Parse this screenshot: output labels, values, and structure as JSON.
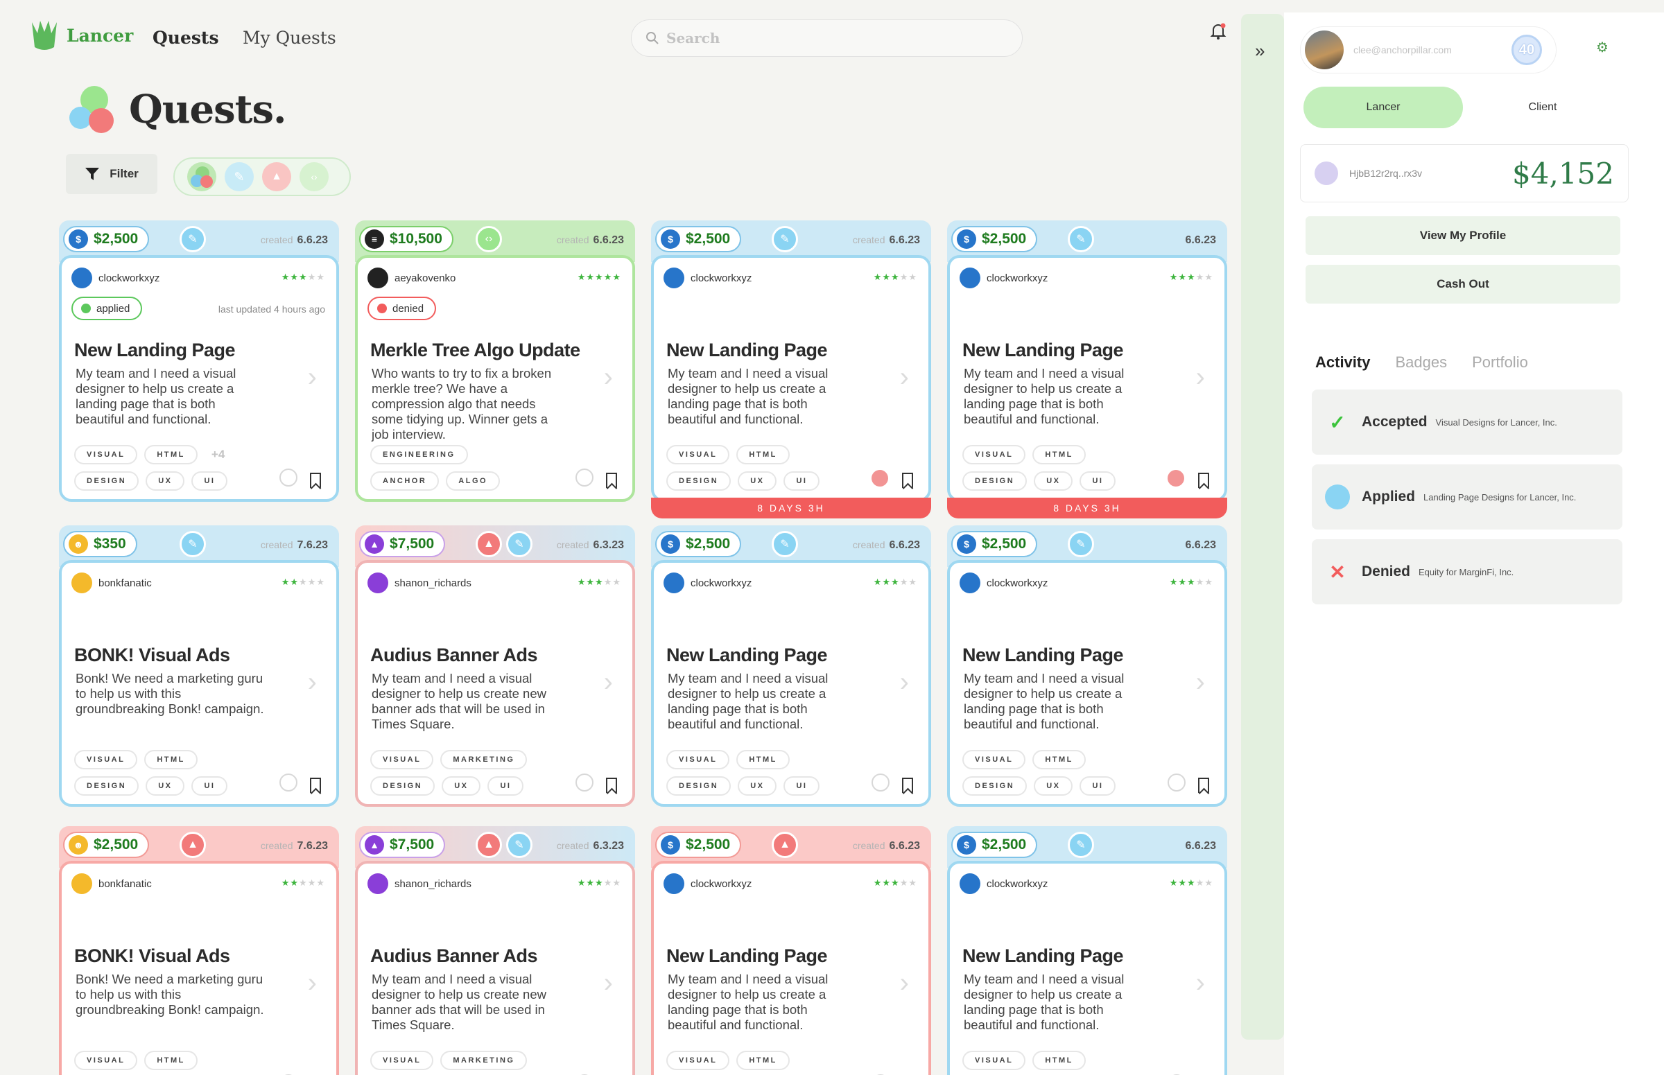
{
  "app": {
    "name": "Lancer",
    "nav": [
      "Quests",
      "My Quests"
    ]
  },
  "search": {
    "placeholder": "Search"
  },
  "page": {
    "title": "Quests.",
    "filter_label": "Filter"
  },
  "colors": {
    "brand": "#3f9c3f",
    "accent_green": "#c3efbb",
    "blue": "#9fd8f1",
    "red": "#f7a9a6"
  },
  "cards": [
    {
      "theme": "blue",
      "bounty": "$2,500",
      "coin": "usdc",
      "cats": [
        "design"
      ],
      "created_label": "created",
      "created": "6.6.23",
      "user": "clockworkxyz",
      "stars": 3,
      "status": "applied",
      "updated": "last updated 4 hours ago",
      "title": "New Landing Page",
      "desc": "My team and I need a visual designer to help us create a landing page that is both beautiful and functional.",
      "tags": [
        [
          "VISUAL",
          "HTML"
        ],
        [
          "DESIGN",
          "UX",
          "UI"
        ]
      ],
      "more": "+4",
      "deadline": ""
    },
    {
      "theme": "green",
      "bounty": "$10,500",
      "coin": "sol",
      "cats": [
        "engineering"
      ],
      "created_label": "created",
      "created": "6.6.23",
      "user": "aeyakovenko",
      "stars": 5,
      "status": "denied",
      "updated": "",
      "title": "Merkle Tree Algo Update",
      "desc": "Who wants to try to fix a broken merkle tree? We have a compression algo that needs some tidying up. Winner gets a job interview.",
      "tags": [
        [
          "ENGINEERING"
        ],
        [
          "ANCHOR",
          "ALGO"
        ]
      ],
      "more": "",
      "deadline": ""
    },
    {
      "theme": "blue",
      "bounty": "$2,500",
      "coin": "usdc",
      "cats": [
        "design"
      ],
      "created_label": "created",
      "created": "6.6.23",
      "user": "clockworkxyz",
      "stars": 3,
      "status": "",
      "updated": "",
      "title": "New Landing Page",
      "desc": "My team and I need a visual designer to help us create a landing page that is both beautiful and functional.",
      "tags": [
        [
          "VISUAL",
          "HTML"
        ],
        [
          "DESIGN",
          "UX",
          "UI"
        ]
      ],
      "more": "",
      "deadline": "8 DAYS 3H"
    },
    {
      "theme": "blue",
      "bounty": "$2,500",
      "coin": "usdc",
      "cats": [
        "design"
      ],
      "created_label": "",
      "created": "6.6.23",
      "user": "clockworkxyz",
      "stars": 3,
      "status": "",
      "updated": "",
      "title": "New Landing Page",
      "desc": "My team and I need a visual designer to help us create a landing page that is both beautiful and functional.",
      "tags": [
        [
          "VISUAL",
          "HTML"
        ],
        [
          "DESIGN",
          "UX",
          "UI"
        ]
      ],
      "more": "",
      "deadline": "8 DAYS 3H"
    },
    {
      "theme": "blue",
      "bounty": "$350",
      "coin": "bonk",
      "cats": [
        "design"
      ],
      "created_label": "created",
      "created": "7.6.23",
      "user": "bonkfanatic",
      "stars": 2,
      "status": "",
      "updated": "",
      "title": "BONK! Visual Ads",
      "desc": "Bonk! We need a marketing guru to help us with this groundbreaking Bonk! campaign.",
      "tags": [
        [
          "VISUAL",
          "HTML"
        ],
        [
          "DESIGN",
          "UX",
          "UI"
        ]
      ],
      "more": "",
      "deadline": ""
    },
    {
      "theme": "mix",
      "bounty": "$7,500",
      "coin": "audius",
      "cats": [
        "marketing",
        "design"
      ],
      "created_label": "created",
      "created": "6.3.23",
      "user": "shanon_richards",
      "stars": 3,
      "status": "",
      "updated": "",
      "title": "Audius Banner Ads",
      "desc": "My team and I need a visual designer to help us create new banner ads that will be used in Times Square.",
      "tags": [
        [
          "VISUAL",
          "MARKETING"
        ],
        [
          "DESIGN",
          "UX",
          "UI"
        ]
      ],
      "more": "",
      "deadline": ""
    },
    {
      "theme": "blue",
      "bounty": "$2,500",
      "coin": "usdc",
      "cats": [
        "design"
      ],
      "created_label": "created",
      "created": "6.6.23",
      "user": "clockworkxyz",
      "stars": 3,
      "status": "",
      "updated": "",
      "title": "New Landing Page",
      "desc": "My team and I need a visual designer to help us create a landing page that is both beautiful and functional.",
      "tags": [
        [
          "VISUAL",
          "HTML"
        ],
        [
          "DESIGN",
          "UX",
          "UI"
        ]
      ],
      "more": "",
      "deadline": ""
    },
    {
      "theme": "blue",
      "bounty": "$2,500",
      "coin": "usdc",
      "cats": [
        "design"
      ],
      "created_label": "",
      "created": "6.6.23",
      "user": "clockworkxyz",
      "stars": 3,
      "status": "",
      "updated": "",
      "title": "New Landing Page",
      "desc": "My team and I need a visual designer to help us create a landing page that is both beautiful and functional.",
      "tags": [
        [
          "VISUAL",
          "HTML"
        ],
        [
          "DESIGN",
          "UX",
          "UI"
        ]
      ],
      "more": "",
      "deadline": ""
    },
    {
      "theme": "red",
      "bounty": "$2,500",
      "coin": "bonk",
      "cats": [
        "marketing"
      ],
      "created_label": "created",
      "created": "7.6.23",
      "user": "bonkfanatic",
      "stars": 2,
      "status": "",
      "updated": "",
      "title": "BONK! Visual Ads",
      "desc": "Bonk! We need a marketing guru to help us with this groundbreaking Bonk! campaign.",
      "tags": [
        [
          "VISUAL",
          "HTML"
        ]
      ],
      "more": "",
      "deadline": ""
    },
    {
      "theme": "mix",
      "bounty": "$7,500",
      "coin": "audius",
      "cats": [
        "marketing",
        "design"
      ],
      "created_label": "created",
      "created": "6.3.23",
      "user": "shanon_richards",
      "stars": 3,
      "status": "",
      "updated": "",
      "title": "Audius Banner Ads",
      "desc": "My team and I need a visual designer to help us create new banner ads that will be used in Times Square.",
      "tags": [
        [
          "VISUAL",
          "MARKETING"
        ]
      ],
      "more": "",
      "deadline": ""
    },
    {
      "theme": "red",
      "bounty": "$2,500",
      "coin": "usdc",
      "cats": [
        "marketing"
      ],
      "created_label": "created",
      "created": "6.6.23",
      "user": "clockworkxyz",
      "stars": 3,
      "status": "",
      "updated": "",
      "title": "New Landing Page",
      "desc": "My team and I need a visual designer to help us create a landing page that is both beautiful and functional.",
      "tags": [
        [
          "VISUAL",
          "HTML"
        ]
      ],
      "more": "",
      "deadline": ""
    },
    {
      "theme": "blue",
      "bounty": "$2,500",
      "coin": "usdc",
      "cats": [
        "design"
      ],
      "created_label": "",
      "created": "6.6.23",
      "user": "clockworkxyz",
      "stars": 3,
      "status": "",
      "updated": "",
      "title": "New Landing Page",
      "desc": "My team and I need a visual designer to help us create a landing page that is both beautiful and functional.",
      "tags": [
        [
          "VISUAL",
          "HTML"
        ]
      ],
      "more": "",
      "deadline": ""
    }
  ],
  "panel": {
    "email": "clee@anchorpillar.com",
    "level": "40",
    "toggle": [
      "Lancer",
      "Client"
    ],
    "wallet_addr": "HjbB12r2rq..rx3v",
    "balance": "$4,152",
    "view_profile": "View My Profile",
    "cash_out": "Cash Out",
    "tabs": [
      "Activity",
      "Badges",
      "Portfolio"
    ],
    "activity": [
      {
        "icon": "check-icon",
        "label": "Accepted",
        "detail": "Visual Designs for Lancer, Inc."
      },
      {
        "icon": "applied-icon",
        "label": "Applied",
        "detail": "Landing Page Designs for Lancer, Inc."
      },
      {
        "icon": "x-icon",
        "label": "Denied",
        "detail": "Equity for MarginFi, Inc."
      }
    ]
  }
}
